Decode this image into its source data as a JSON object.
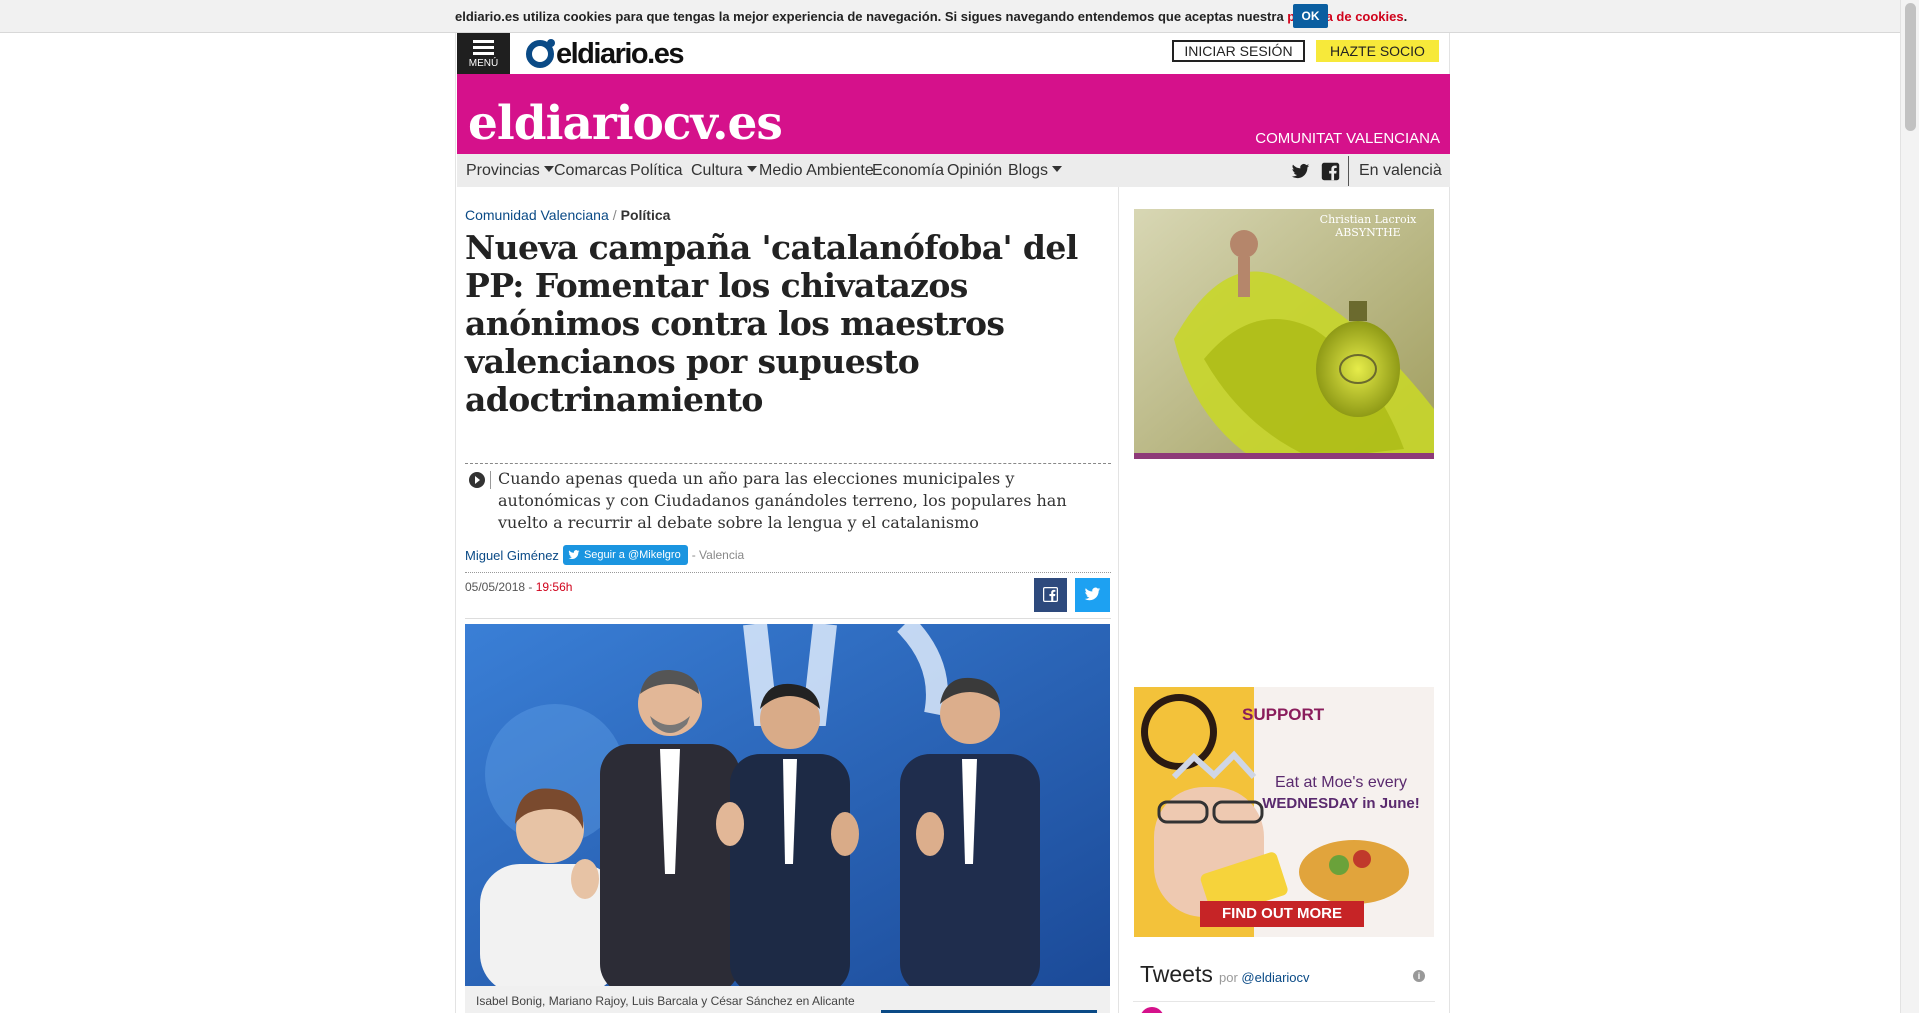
{
  "cookie_bar": {
    "text": "eldiario.es utiliza cookies para que tengas la mejor experiencia de navegación. Si sigues navegando entendemos que aceptas nuestra ",
    "link": "política de cookies",
    "ok": "OK"
  },
  "top_bar": {
    "menu_label": "MENÚ",
    "logo": "eldiario.es",
    "login": "INICIAR SESIÓN",
    "join": "HAZTE SOCIO"
  },
  "masthead": {
    "brand": "eldiariocv.es",
    "region": "COMUNITAT VALENCIANA"
  },
  "nav": {
    "items": [
      {
        "label": "Provincias",
        "dropdown": true
      },
      {
        "label": "Comarcas",
        "dropdown": false
      },
      {
        "label": "Política",
        "dropdown": false
      },
      {
        "label": "Cultura",
        "dropdown": true
      },
      {
        "label": "Medio Ambiente",
        "dropdown": false
      },
      {
        "label": "Economía",
        "dropdown": false
      },
      {
        "label": "Opinión",
        "dropdown": false
      },
      {
        "label": "Blogs",
        "dropdown": true
      }
    ],
    "icons": [
      "twitter-icon",
      "facebook-icon"
    ],
    "language": "En valencià"
  },
  "article": {
    "breadcrumb": {
      "parent": "Comunidad Valenciana",
      "current": "Política"
    },
    "headline": "Nueva campaña 'catalanófoba' del PP: Fomentar los chivatazos anónimos contra los maestros valencianos por supuesto adoctrinamiento",
    "summary": "Cuando apenas queda un año para las elecciones municipales y autonómicas y con Ciudadanos ganándoles terreno, los populares han vuelto a recurrir al debate sobre la lengua y el catalanismo",
    "author": "Miguel Giménez",
    "follow": "Seguir a @Mikelgro",
    "location": "- Valencia",
    "date": "05/05/2018 - ",
    "time": "19:56h",
    "caption": "Isabel Bonig, Mariano Rajoy, Luis Barcala y César Sánchez en Alicante"
  },
  "ads": {
    "ad1_brand": "Christian Lacroix\nABSYNTHE",
    "ad2": {
      "support": "SUPPORT",
      "line1": "Eat at Moe's every",
      "line2": "WEDNESDAY in June!",
      "cta": "FIND OUT MORE"
    }
  },
  "tweets": {
    "title": "Tweets",
    "by": "por ",
    "handle": "@eldiariocv"
  },
  "colors": {
    "masthead": "#d5118b",
    "brand_blue": "#0a4a86",
    "cookie_ok": "#0a5ea0",
    "join": "#f7e93a"
  }
}
